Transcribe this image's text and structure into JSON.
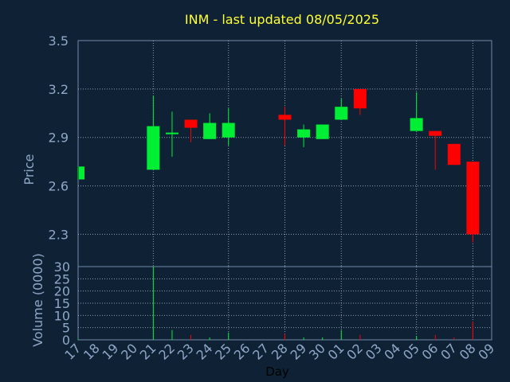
{
  "colors": {
    "background": "#0f2235",
    "plot_background": "#0f2235",
    "frame": "#6f8aa8",
    "grid": "#b8c6d6",
    "title": "#ffff33",
    "axis_text": "#8fa8c8",
    "xlabel": "#000000",
    "up": "#00ee33",
    "down": "#ff0000"
  },
  "chart_data": [
    {
      "type": "candlestick",
      "title": "INM - last updated 08/05/2025",
      "ylabel": "Price",
      "ylim": [
        2.1,
        3.5
      ],
      "yticks": [
        2.3,
        2.6,
        2.9,
        3.2,
        3.5
      ],
      "ytick_labels": [
        "2.3",
        "2.6",
        "2.9",
        "3.2",
        "3.5"
      ],
      "grid": true,
      "x_categories": [
        "17",
        "18",
        "19",
        "20",
        "21",
        "22",
        "23",
        "24",
        "25",
        "26",
        "27",
        "28",
        "29",
        "30",
        "01",
        "02",
        "03",
        "04",
        "05",
        "06",
        "07",
        "08",
        "09"
      ],
      "candles": [
        {
          "x": "17",
          "open": 2.64,
          "high": 2.72,
          "low": 2.64,
          "close": 2.72
        },
        {
          "x": "21",
          "open": 2.7,
          "high": 3.16,
          "low": 2.7,
          "close": 2.97
        },
        {
          "x": "22",
          "open": 2.92,
          "high": 3.06,
          "low": 2.78,
          "close": 2.93
        },
        {
          "x": "23",
          "open": 3.01,
          "high": 3.01,
          "low": 2.87,
          "close": 2.96
        },
        {
          "x": "24",
          "open": 2.89,
          "high": 3.05,
          "low": 2.89,
          "close": 2.99
        },
        {
          "x": "25",
          "open": 2.9,
          "high": 3.08,
          "low": 2.85,
          "close": 2.99
        },
        {
          "x": "28",
          "open": 3.04,
          "high": 3.09,
          "low": 2.85,
          "close": 3.01
        },
        {
          "x": "29",
          "open": 2.9,
          "high": 2.98,
          "low": 2.84,
          "close": 2.95
        },
        {
          "x": "30",
          "open": 2.89,
          "high": 2.98,
          "low": 2.89,
          "close": 2.98
        },
        {
          "x": "01",
          "open": 3.01,
          "high": 3.14,
          "low": 3.01,
          "close": 3.09
        },
        {
          "x": "02",
          "open": 3.2,
          "high": 3.2,
          "low": 3.04,
          "close": 3.08
        },
        {
          "x": "05",
          "open": 2.94,
          "high": 3.18,
          "low": 2.94,
          "close": 3.02
        },
        {
          "x": "06",
          "open": 2.94,
          "high": 2.94,
          "low": 2.7,
          "close": 2.91
        },
        {
          "x": "07",
          "open": 2.86,
          "high": 2.86,
          "low": 2.73,
          "close": 2.73
        },
        {
          "x": "08",
          "open": 2.75,
          "high": 2.75,
          "low": 2.25,
          "close": 2.3
        }
      ]
    },
    {
      "type": "bar",
      "ylabel": "Volume (0000)",
      "xlabel": "Day",
      "ylim": [
        0,
        30
      ],
      "yticks": [
        0,
        5,
        10,
        15,
        20,
        25,
        30
      ],
      "ytick_labels": [
        "0",
        "5",
        "10",
        "15",
        "20",
        "25",
        "30"
      ],
      "grid": true,
      "categories": [
        "17",
        "18",
        "19",
        "20",
        "21",
        "22",
        "23",
        "24",
        "25",
        "26",
        "27",
        "28",
        "29",
        "30",
        "01",
        "02",
        "03",
        "04",
        "05",
        "06",
        "07",
        "08",
        "09"
      ],
      "bars": [
        {
          "x": "17",
          "value": 0.5,
          "direction": "up"
        },
        {
          "x": "21",
          "value": 30,
          "direction": "up"
        },
        {
          "x": "22",
          "value": 4,
          "direction": "up"
        },
        {
          "x": "23",
          "value": 2,
          "direction": "down"
        },
        {
          "x": "24",
          "value": 1,
          "direction": "up"
        },
        {
          "x": "25",
          "value": 3,
          "direction": "up"
        },
        {
          "x": "28",
          "value": 2.5,
          "direction": "down"
        },
        {
          "x": "29",
          "value": 1,
          "direction": "up"
        },
        {
          "x": "30",
          "value": 1,
          "direction": "up"
        },
        {
          "x": "01",
          "value": 4,
          "direction": "up"
        },
        {
          "x": "02",
          "value": 2,
          "direction": "down"
        },
        {
          "x": "05",
          "value": 1.5,
          "direction": "up"
        },
        {
          "x": "06",
          "value": 2,
          "direction": "down"
        },
        {
          "x": "07",
          "value": 1,
          "direction": "down"
        },
        {
          "x": "08",
          "value": 7.5,
          "direction": "down"
        }
      ]
    }
  ]
}
